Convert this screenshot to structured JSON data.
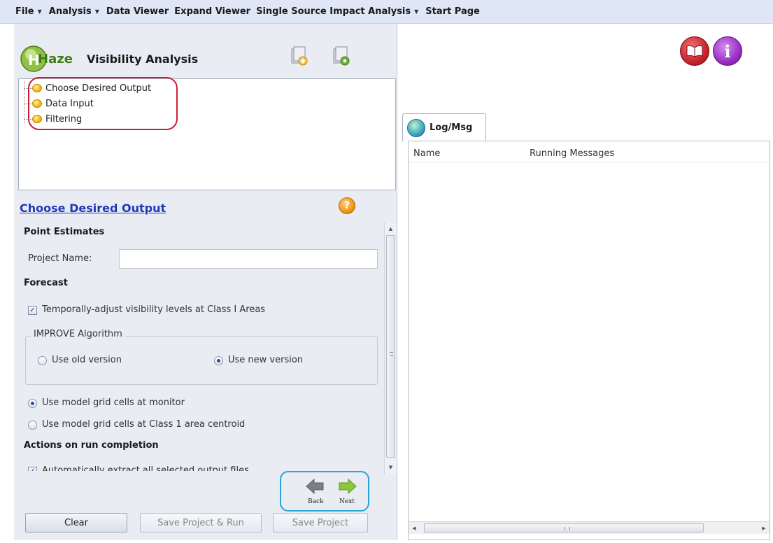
{
  "menubar": {
    "items": [
      {
        "label": "File",
        "has_dropdown": true
      },
      {
        "label": "Analysis",
        "has_dropdown": true
      },
      {
        "label": "Data Viewer",
        "has_dropdown": false
      },
      {
        "label": "Expand Viewer",
        "has_dropdown": false
      },
      {
        "label": "Single Source Impact Analysis",
        "has_dropdown": true
      },
      {
        "label": "Start Page",
        "has_dropdown": false
      }
    ]
  },
  "header": {
    "logo_text": "Haze",
    "title": "Visibility Analysis",
    "icons": [
      "add-project-icon",
      "project-settings-icon"
    ]
  },
  "tree": {
    "items": [
      {
        "label": "Choose Desired Output"
      },
      {
        "label": "Data Input"
      },
      {
        "label": "Filtering"
      }
    ],
    "highlight_color": "#cc1f2e"
  },
  "section": {
    "title": "Choose Desired Output",
    "help_glyph": "?"
  },
  "form": {
    "point_estimates_heading": "Point Estimates",
    "project_name_label": "Project Name:",
    "project_name_value": "",
    "forecast_heading": "Forecast",
    "temporal_adjust_label": "Temporally-adjust visibility levels at Class I Areas",
    "temporal_adjust_checked": true,
    "improve_algorithm_legend": "IMPROVE Algorithm",
    "old_version_label": "Use old version",
    "new_version_label": "Use new version",
    "selected_version": "new",
    "grid_monitor_label": "Use model grid cells at monitor",
    "grid_centroid_label": "Use model grid cells at Class 1 area centroid",
    "selected_grid": "monitor",
    "actions_heading": "Actions on run completion",
    "auto_extract_label": "Automatically extract all selected output files",
    "auto_extract_checked": true
  },
  "navigation": {
    "back_label": "Back",
    "next_label": "Next",
    "highlight_color": "#2aa4d6"
  },
  "buttons": {
    "clear": "Clear",
    "save_run": "Save Project & Run",
    "save": "Save Project"
  },
  "right": {
    "corner_icons": [
      "help-book-icon",
      "info-icon"
    ],
    "info_glyph": "i",
    "tab_label": "Log/Msg",
    "columns": [
      "Name",
      "Running Messages"
    ]
  }
}
